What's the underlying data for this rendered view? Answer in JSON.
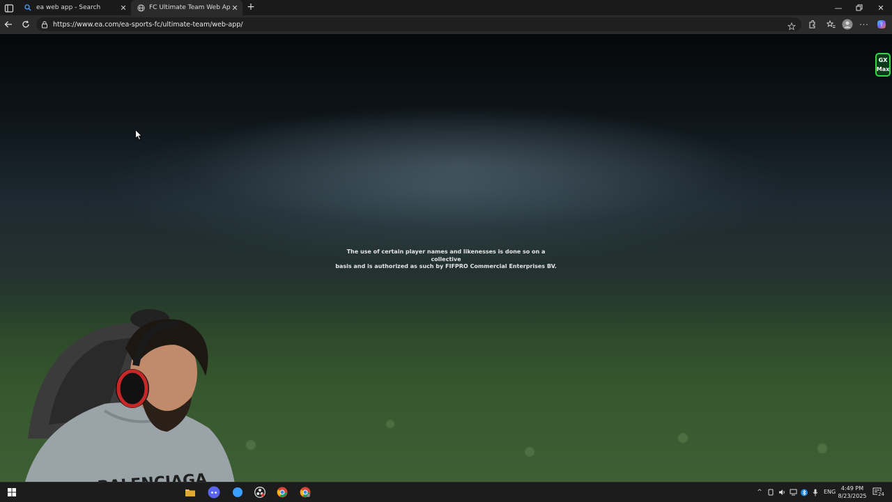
{
  "browser": {
    "tabs": [
      {
        "title": "ea web app - Search",
        "icon": "search-icon",
        "active": false
      },
      {
        "title": "FC Ultimate Team Web App - EA",
        "icon": "globe-icon",
        "active": true
      }
    ],
    "new_tab_icon": "plus-icon",
    "address_bar": {
      "url": "https://www.ea.com/ea-sports-fc/ultimate-team/web-app/"
    },
    "window_controls": [
      "minimize-icon",
      "restore-icon",
      "close-icon"
    ]
  },
  "page": {
    "disclaimer_line1": "The use of certain player names and likenesses is done so on a collective",
    "disclaimer_line2": "basis and is authorized as such by FIFPRO Commercial Enterprises BV.",
    "gx_badge": {
      "line1": "GX",
      "line2": "Max"
    }
  },
  "taskbar": {
    "language": "ENG",
    "time": "4:49 PM",
    "date": "8/23/2025",
    "notification_count": "24"
  },
  "colors": {
    "chrome_dark": "#1a1a1a",
    "toolbar": "#2b2b2b",
    "gx_green": "#2ed84d",
    "taskbar": "#1c1c1c"
  }
}
